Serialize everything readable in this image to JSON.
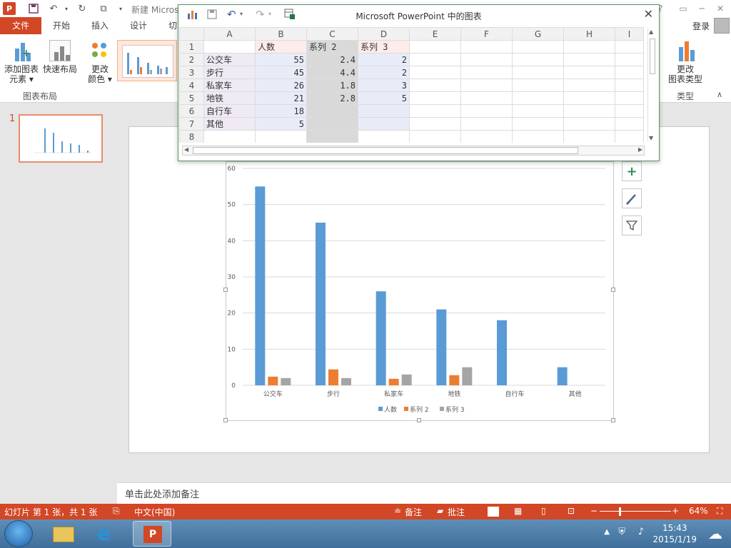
{
  "window": {
    "doc_title": "新建 Micros",
    "controls": [
      "?",
      "□",
      "─",
      "□",
      "✕"
    ]
  },
  "ribbon_tabs": {
    "file": "文件",
    "home": "开始",
    "insert": "插入",
    "design": "设计",
    "transitions": "切",
    "login": "登录"
  },
  "ribbon": {
    "add_element": [
      "添加图表",
      "元素 ▾"
    ],
    "quick_layout": "快速布局",
    "change_colors": [
      "更改",
      "颜色 ▾"
    ],
    "group_chart_layout": "图表布局",
    "change_type": [
      "更改",
      "图表类型"
    ],
    "group_type": "类型"
  },
  "thumbs": {
    "slide_number": "1"
  },
  "notes": {
    "placeholder": "单击此处添加备注"
  },
  "status": {
    "slide_info": "幻灯片 第 1 张，共 1 张",
    "language": "中文(中国)",
    "notes_btn": "备注",
    "comments_btn": "批注",
    "zoom": "64%"
  },
  "taskbar": {
    "time": "15:43",
    "date": "2015/1/19"
  },
  "excel": {
    "title": "Microsoft PowerPoint 中的图表",
    "col_headers": [
      "A",
      "B",
      "C",
      "D",
      "E",
      "F",
      "G",
      "H",
      "I"
    ],
    "row_headers": [
      "1",
      "2",
      "3",
      "4",
      "5",
      "6",
      "7",
      "8"
    ],
    "rows": [
      [
        "",
        "人数",
        "系列 2",
        "系列 3"
      ],
      [
        "公交车",
        "55",
        "2.4",
        "2"
      ],
      [
        "步行",
        "45",
        "4.4",
        "2"
      ],
      [
        "私家车",
        "26",
        "1.8",
        "3"
      ],
      [
        "地铁",
        "21",
        "2.8",
        "5"
      ],
      [
        "自行车",
        "18",
        "",
        ""
      ],
      [
        "其他",
        "5",
        "",
        ""
      ],
      [
        "",
        "",
        "",
        ""
      ]
    ]
  },
  "chart_data": {
    "type": "bar",
    "categories": [
      "公交车",
      "步行",
      "私家车",
      "地铁",
      "自行车",
      "其他"
    ],
    "series": [
      {
        "name": "人数",
        "values": [
          55,
          45,
          26,
          21,
          18,
          5
        ],
        "color": "#5b9bd5"
      },
      {
        "name": "系列 2",
        "values": [
          2.4,
          4.4,
          1.8,
          2.8,
          null,
          null
        ],
        "color": "#ed7d31"
      },
      {
        "name": "系列 3",
        "values": [
          2,
          2,
          3,
          5,
          null,
          null
        ],
        "color": "#a5a5a5"
      }
    ],
    "yticks": [
      "0",
      "10",
      "20",
      "30",
      "40",
      "50",
      "60"
    ],
    "ylim": [
      0,
      60
    ],
    "grid": true,
    "legend": "bottom"
  }
}
